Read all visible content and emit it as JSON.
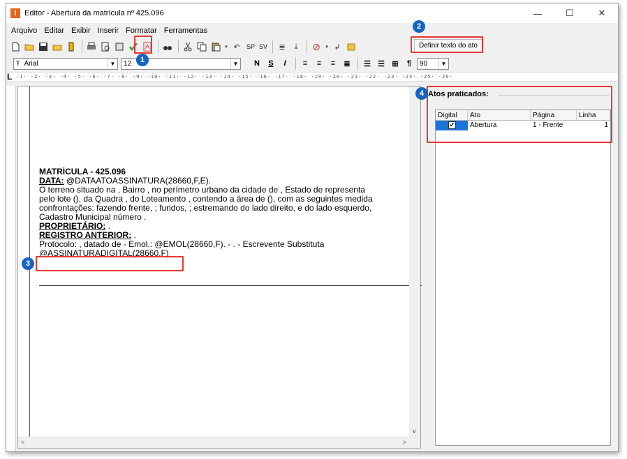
{
  "window": {
    "title": "Editor - Abertura da matrícula nº 425.096",
    "app_icon": "I",
    "minimize": "—",
    "maximize": "☐",
    "close": "✕"
  },
  "menu": [
    "Arquivo",
    "Editar",
    "Exibir",
    "Inserir",
    "Formatar",
    "Ferramentas"
  ],
  "toolbar": {
    "sp_label": "SP",
    "sv_label": "SV",
    "define_button": "Definir texto do ato"
  },
  "format": {
    "font": "Arial",
    "size": "12",
    "zoom": "90",
    "bold": "N",
    "underline": "S",
    "italic": "I",
    "pilcrow": "¶"
  },
  "ruler": {
    "corner": "L",
    "ticks": "·1·  ·2·  ·3·  ·4·  ·5·  ·6·  ·7·  ·8·  ·9·  ·10·  ·11·  ·12·  ·13·  ·14·  ·15·  ·16·  ·17·  ·18·  ·19·  ·20·  ·21·  ·22·  ·23·  ·24·  ·25·  ·26·"
  },
  "document": {
    "title": "MATRÍCULA - 425.096",
    "data_label": "DATA:",
    "data_value": " @DATAATOASSINATURA(28660,F,E).",
    "body1": "O terreno situado na  , Bairro , no perímetro urbano da cidade de , Estado de representa",
    "body2": "pelo lote  (), da Quadra , do Loteamento , contendo a área de  (), com as seguintes medida",
    "body3": "confrontações: fazendo frente, ; fundos, ; estremando do lado direito,  e do lado esquerdo,",
    "body4": "Cadastro Municipal número .",
    "owner_label": "PROPRIETÁRIO:",
    "owner_value": " .",
    "prev_label": "REGISTRO ANTERIOR:",
    "prev_value": " .",
    "protocol": "Protocolo: , datado de  - Emol.: @EMOL(28660,F). - . - Escrevente Substituta",
    "signature": "@ASSINATURADIGITAL(28660,F)"
  },
  "panel": {
    "title": "Atos praticados:",
    "columns": [
      "Digital",
      "Ato",
      "Página",
      "Linha"
    ],
    "rows": [
      {
        "digital": "✔",
        "ato": "Abertura",
        "pagina": "1 - Frente",
        "linha": "1"
      }
    ]
  },
  "callouts": {
    "one": "1",
    "two": "2",
    "three": "3",
    "four": "4"
  },
  "colors": {
    "callout": "#e53935",
    "badge": "#1565c0",
    "selection": "#1a73d9",
    "check": "#2e9e3e"
  }
}
